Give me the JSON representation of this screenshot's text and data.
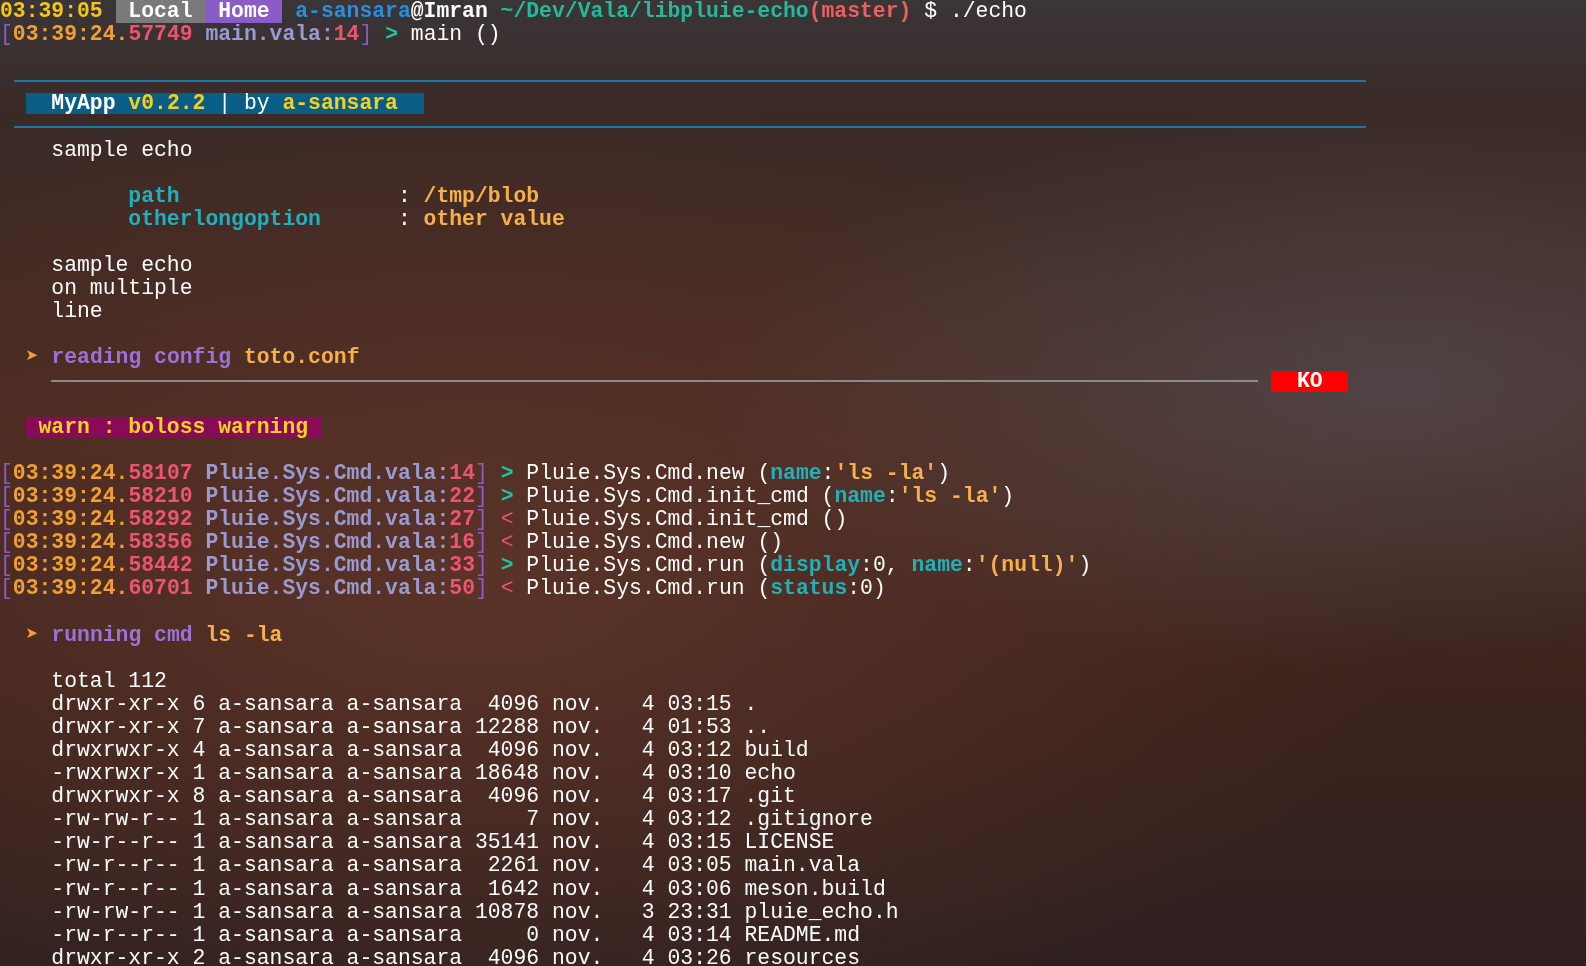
{
  "rows": [
    {
      "kind": "prompt",
      "segments": [
        {
          "kind": "time",
          "text": "03:39:05"
        },
        {
          "kind": "tag",
          "text": "Local",
          "color": "#7a7a7a"
        },
        {
          "kind": "tag",
          "text": "Home",
          "color": "#8a5cc8"
        },
        {
          "kind": "user",
          "text": "a-sansara"
        },
        {
          "kind": "host",
          "text": "@Imran"
        },
        {
          "kind": "path",
          "text": "~/Dev/Vala/libpluie-echo"
        },
        {
          "kind": "branch",
          "text": "(master)"
        },
        {
          "kind": "command",
          "text": "$ ./echo"
        }
      ]
    },
    {
      "kind": "log",
      "segments": [
        {
          "kind": "bracket",
          "text": "["
        },
        {
          "kind": "clock",
          "text": "03:39:24."
        },
        {
          "kind": "micro",
          "text": "57749"
        },
        {
          "kind": "source",
          "text": " main.vala:"
        },
        {
          "kind": "lineno",
          "text": "14"
        },
        {
          "kind": "bracket",
          "text": "]"
        },
        {
          "kind": "enter",
          "text": " >"
        },
        {
          "kind": "call",
          "text": " main ()"
        }
      ]
    },
    {
      "kind": "blank"
    },
    {
      "kind": "rule"
    },
    {
      "kind": "banner",
      "segments": [
        {
          "kind": "title",
          "text": "MyApp"
        },
        {
          "kind": "version",
          "text": " v0.2.2"
        },
        {
          "kind": "plain",
          "text": " | by "
        },
        {
          "kind": "version",
          "text": "a-sansara"
        }
      ]
    },
    {
      "kind": "rule"
    },
    {
      "kind": "text",
      "text": "sample echo"
    },
    {
      "kind": "blank"
    },
    {
      "kind": "option",
      "key": "path",
      "separator": ":",
      "value": "/tmp/blob"
    },
    {
      "kind": "option",
      "key": "otherlongoption",
      "separator": ":",
      "value": "other value"
    },
    {
      "kind": "blank"
    },
    {
      "kind": "text",
      "text": "sample echo"
    },
    {
      "kind": "text",
      "text": "on multiple"
    },
    {
      "kind": "text",
      "text": "line"
    },
    {
      "kind": "blank"
    },
    {
      "kind": "step",
      "marker": "➤",
      "label": "reading config",
      "target": "toto.conf"
    },
    {
      "kind": "result",
      "status": "KO"
    },
    {
      "kind": "blank"
    },
    {
      "kind": "warning",
      "text": "warn : boloss warning"
    },
    {
      "kind": "blank"
    },
    {
      "kind": "log",
      "segments": [
        {
          "kind": "bracket",
          "text": "["
        },
        {
          "kind": "clock",
          "text": "03:39:24."
        },
        {
          "kind": "micro",
          "text": "58107"
        },
        {
          "kind": "source",
          "text": " Pluie.Sys.Cmd.vala:"
        },
        {
          "kind": "lineno",
          "text": "14"
        },
        {
          "kind": "bracket",
          "text": "]"
        },
        {
          "kind": "enter",
          "text": " >"
        },
        {
          "kind": "call",
          "text": " Pluie.Sys.Cmd.new ("
        },
        {
          "kind": "key",
          "text": "name"
        },
        {
          "kind": "call",
          "text": ":"
        },
        {
          "kind": "value",
          "text": "'ls -la'"
        },
        {
          "kind": "call",
          "text": ")"
        }
      ]
    },
    {
      "kind": "log",
      "segments": [
        {
          "kind": "bracket",
          "text": "["
        },
        {
          "kind": "clock",
          "text": "03:39:24."
        },
        {
          "kind": "micro",
          "text": "58210"
        },
        {
          "kind": "source",
          "text": " Pluie.Sys.Cmd.vala:"
        },
        {
          "kind": "lineno",
          "text": "22"
        },
        {
          "kind": "bracket",
          "text": "]"
        },
        {
          "kind": "enter",
          "text": " >"
        },
        {
          "kind": "call",
          "text": " Pluie.Sys.Cmd.init_cmd ("
        },
        {
          "kind": "key",
          "text": "name"
        },
        {
          "kind": "call",
          "text": ":"
        },
        {
          "kind": "value",
          "text": "'ls -la'"
        },
        {
          "kind": "call",
          "text": ")"
        }
      ]
    },
    {
      "kind": "log",
      "segments": [
        {
          "kind": "bracket",
          "text": "["
        },
        {
          "kind": "clock",
          "text": "03:39:24."
        },
        {
          "kind": "micro",
          "text": "58292"
        },
        {
          "kind": "source",
          "text": " Pluie.Sys.Cmd.vala:"
        },
        {
          "kind": "lineno",
          "text": "27"
        },
        {
          "kind": "bracket",
          "text": "]"
        },
        {
          "kind": "leave",
          "text": " <"
        },
        {
          "kind": "call",
          "text": " Pluie.Sys.Cmd.init_cmd ()"
        }
      ]
    },
    {
      "kind": "log",
      "segments": [
        {
          "kind": "bracket",
          "text": "["
        },
        {
          "kind": "clock",
          "text": "03:39:24."
        },
        {
          "kind": "micro",
          "text": "58356"
        },
        {
          "kind": "source",
          "text": " Pluie.Sys.Cmd.vala:"
        },
        {
          "kind": "lineno",
          "text": "16"
        },
        {
          "kind": "bracket",
          "text": "]"
        },
        {
          "kind": "leave",
          "text": " <"
        },
        {
          "kind": "call",
          "text": " Pluie.Sys.Cmd.new ()"
        }
      ]
    },
    {
      "kind": "log",
      "segments": [
        {
          "kind": "bracket",
          "text": "["
        },
        {
          "kind": "clock",
          "text": "03:39:24."
        },
        {
          "kind": "micro",
          "text": "58442"
        },
        {
          "kind": "source",
          "text": " Pluie.Sys.Cmd.vala:"
        },
        {
          "kind": "lineno",
          "text": "33"
        },
        {
          "kind": "bracket",
          "text": "]"
        },
        {
          "kind": "enter",
          "text": " >"
        },
        {
          "kind": "call",
          "text": " Pluie.Sys.Cmd.run ("
        },
        {
          "kind": "key",
          "text": "display"
        },
        {
          "kind": "call",
          "text": ":0, "
        },
        {
          "kind": "key",
          "text": "name"
        },
        {
          "kind": "call",
          "text": ":"
        },
        {
          "kind": "value",
          "text": "'(null)'"
        },
        {
          "kind": "call",
          "text": ")"
        }
      ]
    },
    {
      "kind": "log",
      "segments": [
        {
          "kind": "bracket",
          "text": "["
        },
        {
          "kind": "clock",
          "text": "03:39:24."
        },
        {
          "kind": "micro",
          "text": "60701"
        },
        {
          "kind": "source",
          "text": " Pluie.Sys.Cmd.vala:"
        },
        {
          "kind": "lineno",
          "text": "50"
        },
        {
          "kind": "bracket",
          "text": "]"
        },
        {
          "kind": "leave",
          "text": " <"
        },
        {
          "kind": "call",
          "text": " Pluie.Sys.Cmd.run ("
        },
        {
          "kind": "key",
          "text": "status"
        },
        {
          "kind": "call",
          "text": ":0)"
        }
      ]
    },
    {
      "kind": "blank"
    },
    {
      "kind": "step",
      "marker": "➤",
      "label": "running cmd",
      "target": "ls -la"
    },
    {
      "kind": "blank"
    },
    {
      "kind": "text",
      "text": "total 112"
    },
    {
      "kind": "text",
      "text": "drwxr-xr-x 6 a-sansara a-sansara  4096 nov.   4 03:15 ."
    },
    {
      "kind": "text",
      "text": "drwxr-xr-x 7 a-sansara a-sansara 12288 nov.   4 01:53 .."
    },
    {
      "kind": "text",
      "text": "drwxrwxr-x 4 a-sansara a-sansara  4096 nov.   4 03:12 build"
    },
    {
      "kind": "text",
      "text": "-rwxrwxr-x 1 a-sansara a-sansara 18648 nov.   4 03:10 echo"
    },
    {
      "kind": "text",
      "text": "drwxrwxr-x 8 a-sansara a-sansara  4096 nov.   4 03:17 .git"
    },
    {
      "kind": "text",
      "text": "-rw-rw-r-- 1 a-sansara a-sansara     7 nov.   4 03:12 .gitignore"
    },
    {
      "kind": "text",
      "text": "-rw-r--r-- 1 a-sansara a-sansara 35141 nov.   4 03:15 LICENSE"
    },
    {
      "kind": "text",
      "text": "-rw-r--r-- 1 a-sansara a-sansara  2261 nov.   4 03:05 main.vala"
    },
    {
      "kind": "text",
      "text": "-rw-r--r-- 1 a-sansara a-sansara  1642 nov.   4 03:06 meson.build"
    },
    {
      "kind": "text",
      "text": "-rw-rw-r-- 1 a-sansara a-sansara 10878 nov.   3 23:31 pluie_echo.h"
    },
    {
      "kind": "text",
      "text": "-rw-r--r-- 1 a-sansara a-sansara     0 nov.   4 03:14 README.md"
    },
    {
      "kind": "text",
      "text": "drwxr-xr-x 2 a-sansara a-sansara  4096 nov.   4 03:26 resources"
    }
  ]
}
